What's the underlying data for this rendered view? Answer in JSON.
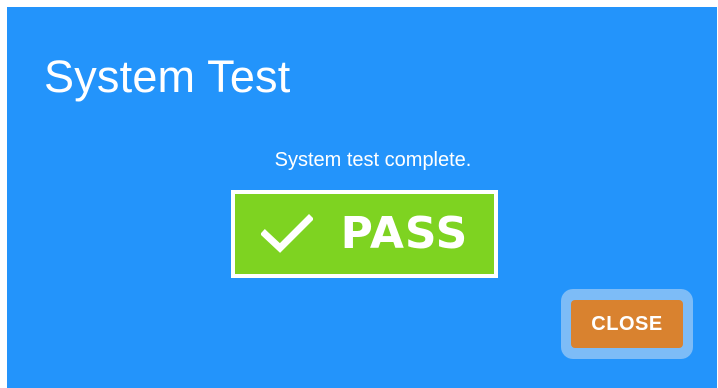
{
  "dialog": {
    "title": "System Test",
    "message": "System test complete.",
    "background_color": "#2394fb"
  },
  "result": {
    "icon": "checkmark-icon",
    "label": "PASS",
    "color": "#7ed321"
  },
  "actions": {
    "close_label": "CLOSE",
    "close_color": "#d9822f"
  }
}
